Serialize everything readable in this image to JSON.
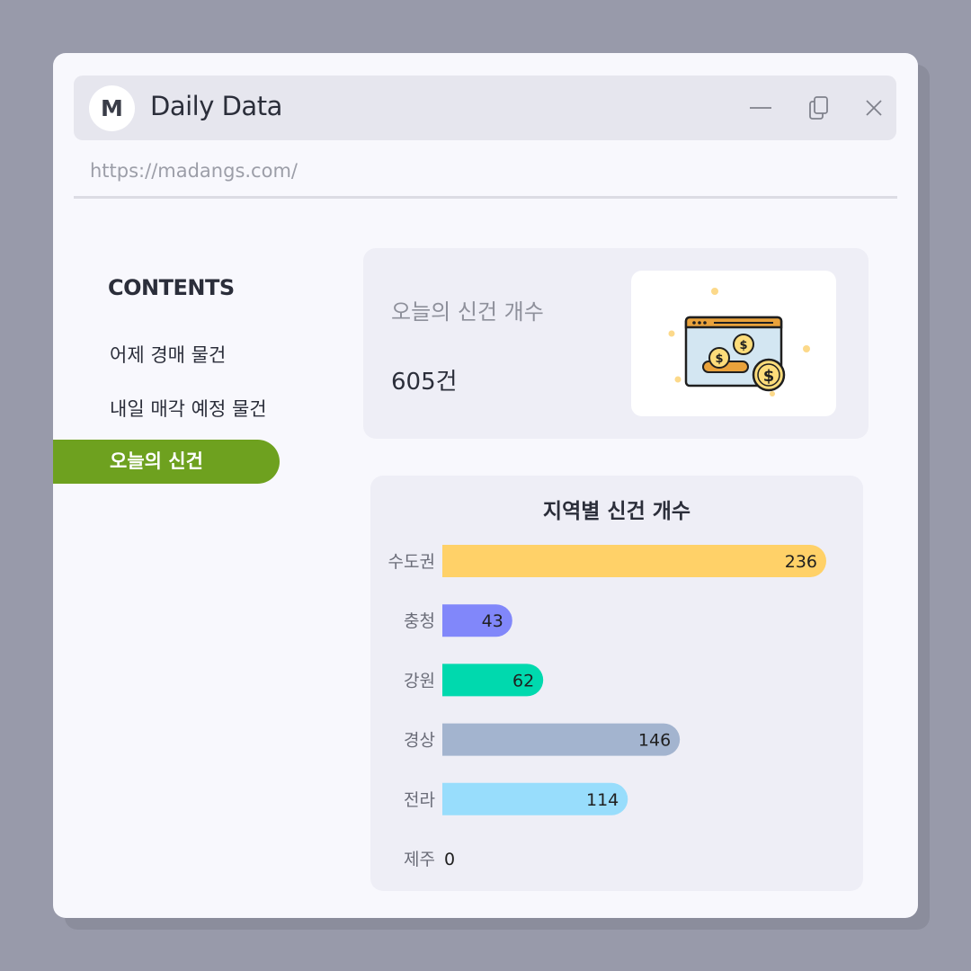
{
  "window": {
    "logo_letter": "M",
    "title": "Daily Data",
    "url": "https://madangs.com/",
    "icons": [
      "minimize-icon",
      "copy-icon",
      "close-icon"
    ]
  },
  "sidebar": {
    "heading": "CONTENTS",
    "items": [
      {
        "label": "어제 경매 물건",
        "active": false
      },
      {
        "label": "내일 매각 예정 물건",
        "active": false
      },
      {
        "label": "오늘의 신건",
        "active": true
      }
    ],
    "active_color": "#6ea11f"
  },
  "today_card": {
    "label": "오늘의 신건 개수",
    "value": "605건",
    "illustration": "browser-coins-icon"
  },
  "chart_data": {
    "type": "bar",
    "orientation": "horizontal",
    "title": "지역별 신건 개수",
    "categories": [
      "수도권",
      "충청",
      "강원",
      "경상",
      "전라",
      "제주"
    ],
    "values": [
      236,
      43,
      62,
      146,
      114,
      0
    ],
    "colors": [
      "#ffd168",
      "#8187fa",
      "#00d9ae",
      "#a3b4cf",
      "#98ddfc",
      "#cccccc"
    ],
    "xlim": [
      0,
      236
    ],
    "grid": false,
    "data_labels": true
  }
}
